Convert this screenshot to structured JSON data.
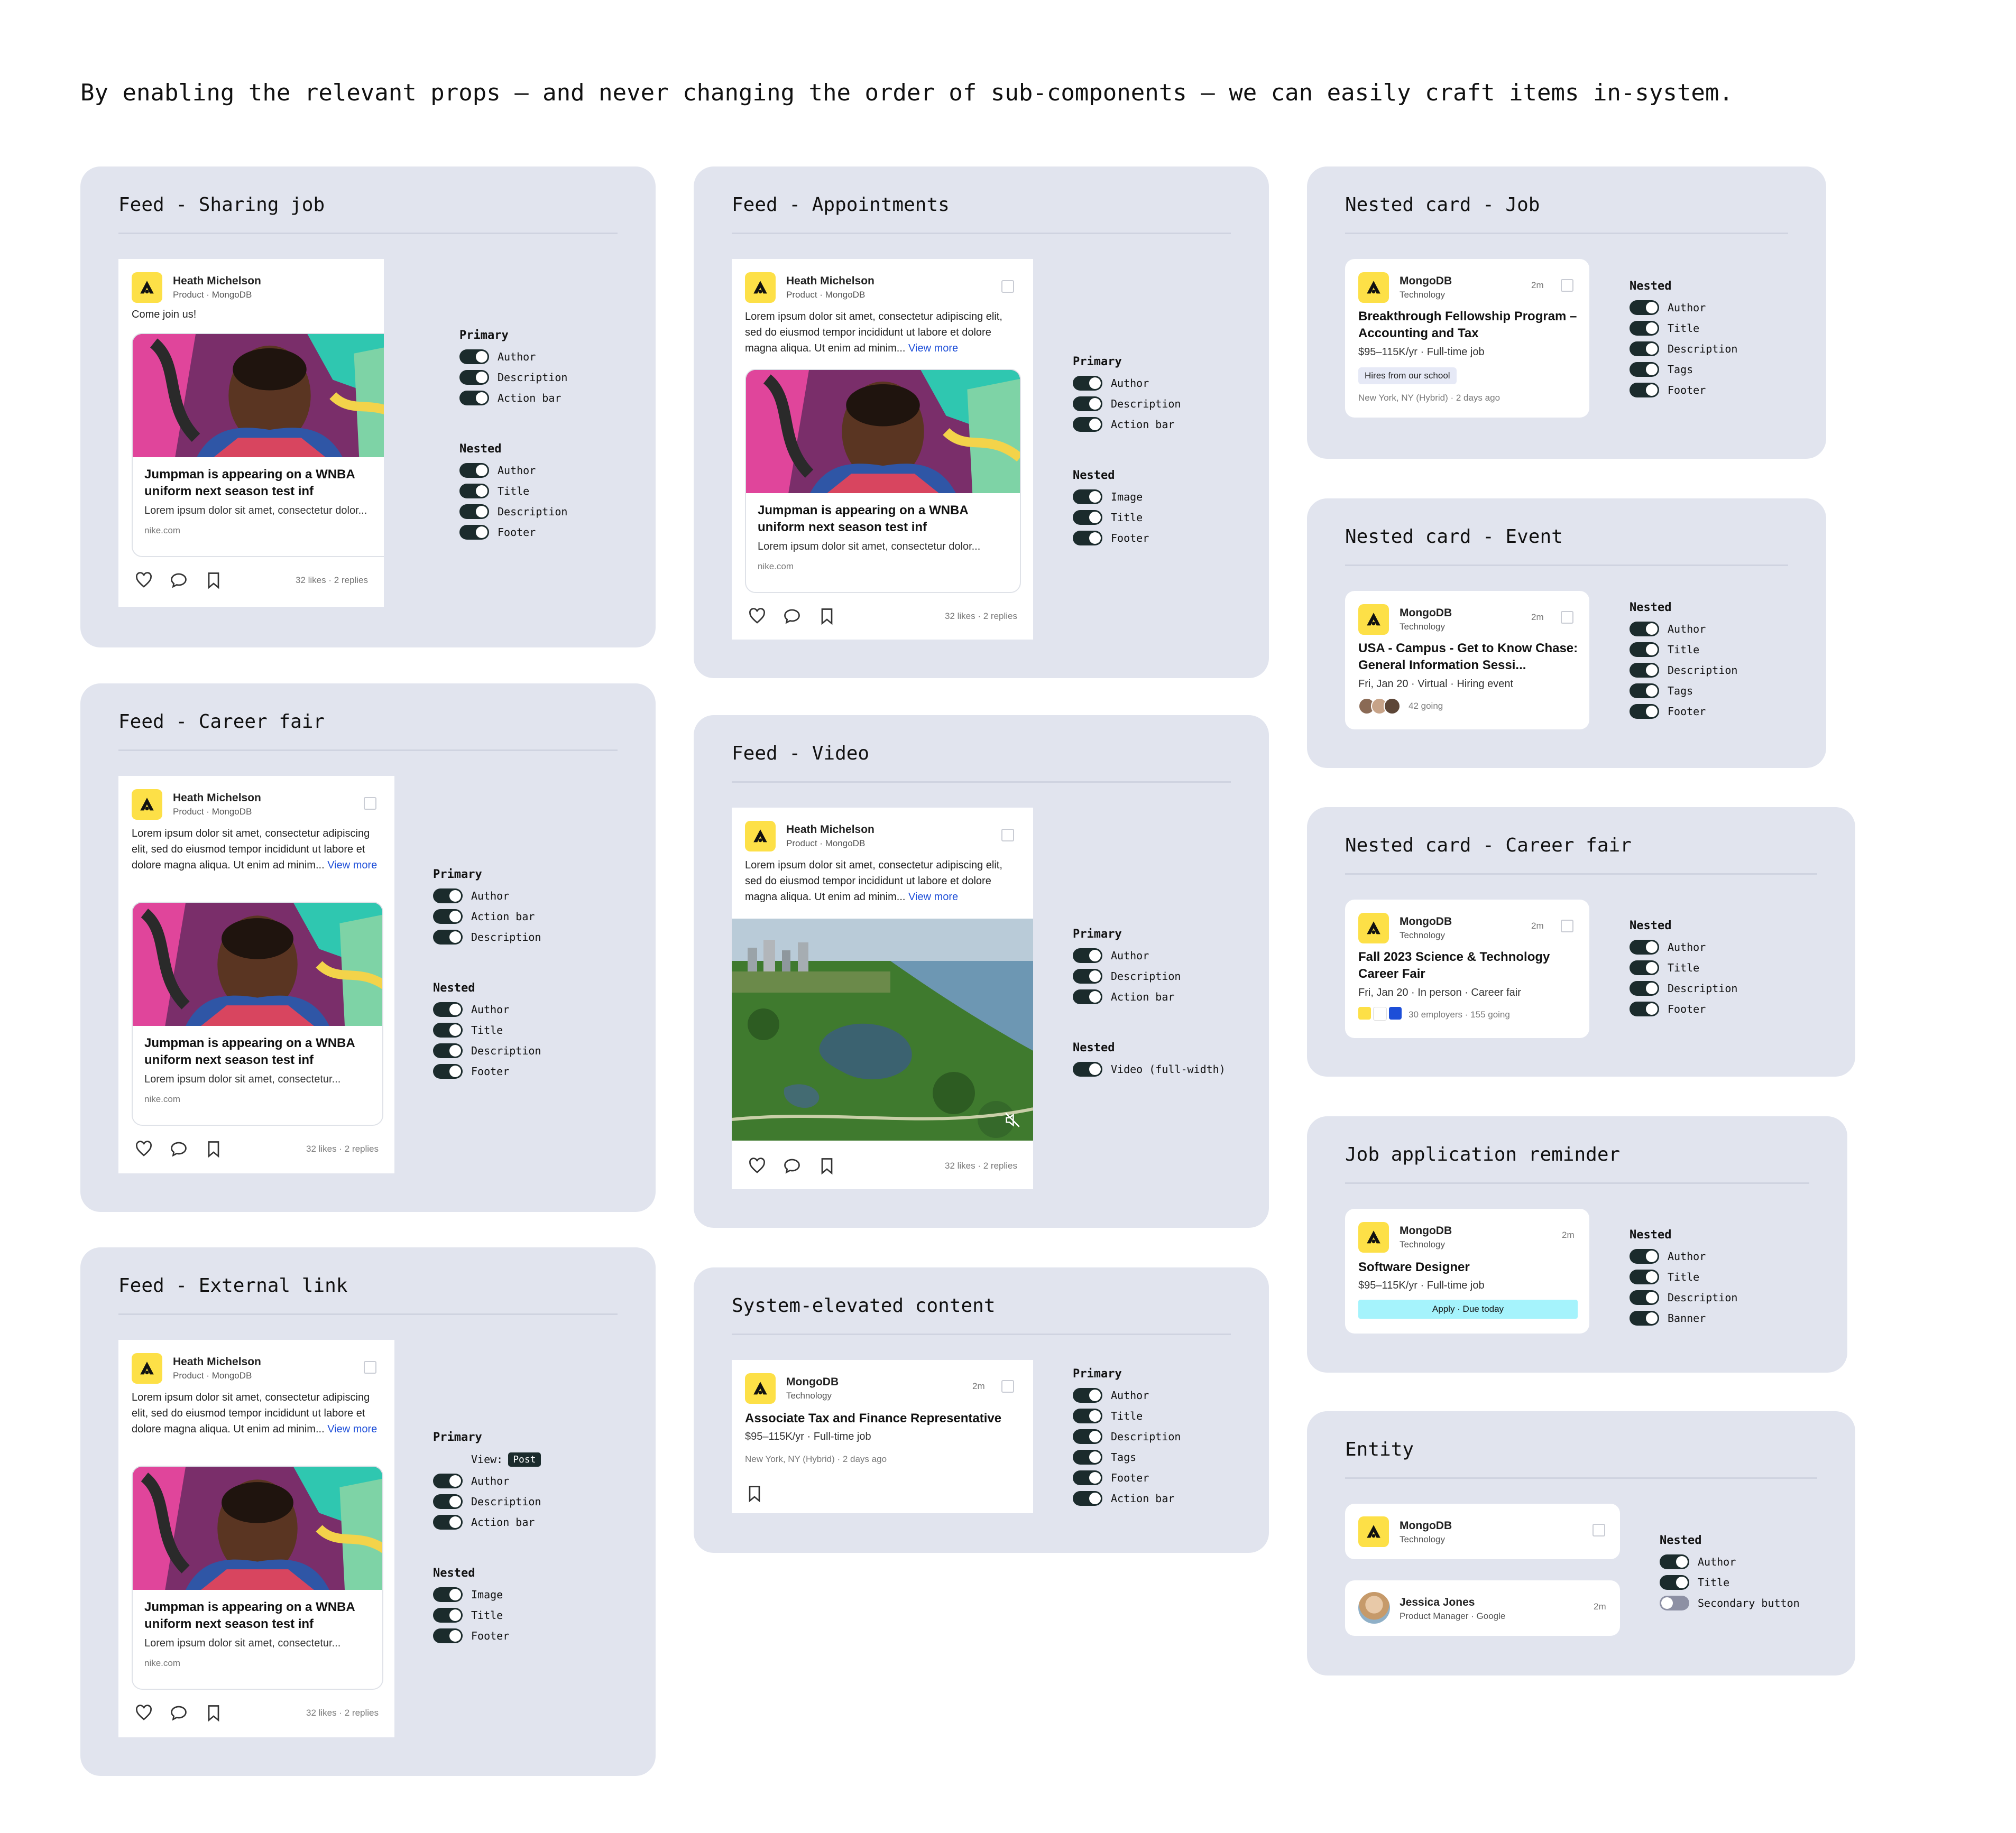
{
  "headline": "By enabling the relevant props — and never changing the order of sub-components — we can easily craft items in-system.",
  "colors": {
    "panel_bg": "#e1e4ee",
    "toggle_on": "#1b2b2c",
    "toggle_off": "#8d90a4",
    "logo_bg": "#fde047",
    "link": "#1d4ed8",
    "banner": "#a5f3fc",
    "tag_bg": "#e6e9f6"
  },
  "common": {
    "author_name": "Heath Michelson",
    "author_sub": "Product · MongoDB",
    "view_more": "View more",
    "lorem": "Lorem ipsum dolor sit amet, consectetur adipiscing elit, sed do eiusmod tempor incididunt ut labore et dolore magna aliqua. Ut enim ad minim...",
    "lorem_narrow": "Lorem ipsum dolor sit amet, consectetur adipiscing elit, sed do eiusmod tempor incididunt ut labore et dolore magna aliqua. Ut enim ad minim...",
    "stats": "32 likes · 2 replies",
    "nested_title": "Jumpman is appearing on a WNBA uniform next season test inf",
    "nested_desc": "Lorem ipsum dolor sit amet, consectetur dolor...",
    "nested_desc_short": "Lorem ipsum dolor sit amet, consectetur...",
    "nested_src": "nike.com",
    "company": "MongoDB",
    "company_sub": "Technology",
    "time": "2m",
    "icons": [
      "heart-icon",
      "comment-icon",
      "bookmark-icon",
      "checkbox-icon",
      "mute-icon"
    ]
  },
  "panels": {
    "sharing": {
      "title": "Feed - Sharing job",
      "post_text": "Come join us!",
      "primary": {
        "label": "Primary",
        "items": [
          "Author",
          "Description",
          "Action bar"
        ]
      },
      "nested": {
        "label": "Nested",
        "items": [
          "Author",
          "Title",
          "Description",
          "Footer"
        ]
      }
    },
    "appointments": {
      "title": "Feed - Appointments",
      "primary": {
        "label": "Primary",
        "items": [
          "Author",
          "Description",
          "Action bar"
        ]
      },
      "nested": {
        "label": "Nested",
        "items": [
          "Image",
          "Title",
          "Footer"
        ]
      }
    },
    "nested_job": {
      "title": "Nested card - Job",
      "card_title": "Breakthrough Fellowship Program – Accounting and Tax",
      "desc": "$95–115K/yr · Full-time job",
      "tag": "Hires from our school",
      "footer": "New York, NY (Hybrid) · 2 days ago",
      "nested": {
        "label": "Nested",
        "items": [
          "Author",
          "Title",
          "Description",
          "Tags",
          "Footer"
        ]
      }
    },
    "career": {
      "title": "Feed - Career fair",
      "primary": {
        "label": "Primary",
        "items": [
          "Author",
          "Action bar",
          "Description"
        ]
      },
      "nested": {
        "label": "Nested",
        "items": [
          "Author",
          "Title",
          "Description",
          "Footer"
        ]
      }
    },
    "video": {
      "title": "Feed - Video",
      "primary": {
        "label": "Primary",
        "items": [
          "Author",
          "Description",
          "Action bar"
        ]
      },
      "nested": {
        "label": "Nested",
        "items": [
          "Video (full-width)"
        ]
      }
    },
    "nested_event": {
      "title": "Nested card - Event",
      "card_title": "USA - Campus - Get to Know Chase: General Information Sessi...",
      "desc": "Fri, Jan 20 · Virtual · Hiring event",
      "going": "42 going",
      "nested": {
        "label": "Nested",
        "items": [
          "Author",
          "Title",
          "Description",
          "Tags",
          "Footer"
        ]
      }
    },
    "nested_career": {
      "title": "Nested card - Career fair",
      "card_title": "Fall 2023 Science & Technology Career Fair",
      "desc": "Fri, Jan 20 · In person · Career fair",
      "footer": "30 employers · 155 going",
      "nested": {
        "label": "Nested",
        "items": [
          "Author",
          "Title",
          "Description",
          "Footer"
        ]
      }
    },
    "external": {
      "title": "Feed - External link",
      "primary": {
        "label": "Primary",
        "view_label": "View:",
        "view_value": "Post",
        "items": [
          "Author",
          "Description",
          "Action bar"
        ]
      },
      "nested": {
        "label": "Nested",
        "items": [
          "Image",
          "Title",
          "Footer"
        ]
      }
    },
    "elevated": {
      "title": "System-elevated content",
      "card_title": "Associate Tax and Finance Representative",
      "desc": "$95–115K/yr · Full-time job",
      "footer": "New York, NY (Hybrid) · 2 days ago",
      "primary": {
        "label": "Primary",
        "items": [
          "Author",
          "Title",
          "Description",
          "Tags",
          "Footer",
          "Action bar"
        ]
      }
    },
    "reminder": {
      "title": "Job application reminder",
      "card_title": "Software Designer",
      "desc": "$95–115K/yr · Full-time job",
      "banner": "Apply · Due today",
      "nested": {
        "label": "Nested",
        "items": [
          "Author",
          "Title",
          "Description",
          "Banner"
        ]
      }
    },
    "entity": {
      "title": "Entity",
      "person_name": "Jessica Jones",
      "person_sub": "Product Manager · Google",
      "nested": {
        "label": "Nested",
        "items": [
          "Author",
          "Title",
          "Secondary button"
        ],
        "secondary_on": false
      }
    }
  }
}
